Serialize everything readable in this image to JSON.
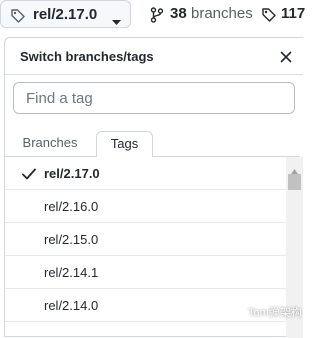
{
  "topbar": {
    "current_ref": "rel/2.17.0",
    "branches": {
      "count": "38",
      "label": "branches"
    },
    "tags": {
      "count": "117"
    }
  },
  "panel": {
    "title": "Switch branches/tags",
    "filter_placeholder": "Find a tag",
    "tabs": [
      {
        "label": "Branches",
        "selected": false
      },
      {
        "label": "Tags",
        "selected": true
      }
    ],
    "items": [
      {
        "name": "rel/2.17.0",
        "selected": true
      },
      {
        "name": "rel/2.16.0",
        "selected": false
      },
      {
        "name": "rel/2.15.0",
        "selected": false
      },
      {
        "name": "rel/2.14.1",
        "selected": false
      },
      {
        "name": "rel/2.14.0",
        "selected": false
      }
    ]
  },
  "watermark": {
    "text": "Tom弹架构"
  },
  "colors": {
    "text": "#24292f",
    "muted": "#57606a",
    "border": "#d0d7de",
    "button_bg": "#f6f8fa"
  },
  "icons": [
    "tag-icon",
    "caret-down-icon",
    "git-branch-icon",
    "close-icon",
    "check-icon"
  ]
}
